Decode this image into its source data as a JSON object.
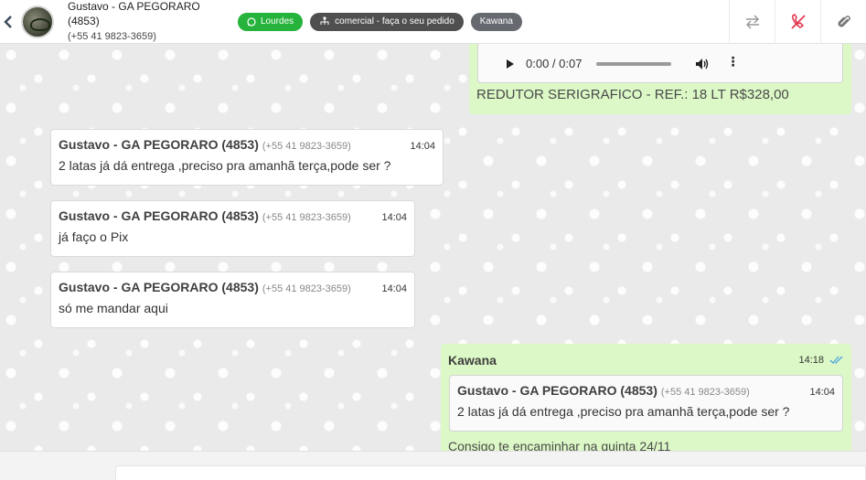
{
  "header": {
    "contact_name": "Gustavo - GA PEGORARO (4853)",
    "contact_phone": "(+55 41 9823-3659)",
    "tags": [
      {
        "label": "Lourdes",
        "icon": "whatsapp-icon",
        "color": "#25b33b"
      },
      {
        "label": "comercial - faça o seu pedido",
        "icon": "sitemap-icon",
        "color": "#4f4f4f"
      },
      {
        "label": "Kawana",
        "color": "#666a70"
      }
    ],
    "actions": [
      "transfer-icon",
      "end-call-icon",
      "attach-icon"
    ]
  },
  "messages": {
    "audio": {
      "time": "0:00 / 0:07",
      "caption": "REDUTOR SERIGRAFICO - REF.: 18 LT R$328,00"
    },
    "incoming": [
      {
        "sender": "Gustavo - GA PEGORARO (4853)",
        "number": "(+55 41 9823-3659)",
        "time": "14:04",
        "text": "2 latas já dá entrega ,preciso pra amanhã terça,pode ser ?"
      },
      {
        "sender": "Gustavo - GA PEGORARO (4853)",
        "number": "(+55 41 9823-3659)",
        "time": "14:04",
        "text": "já faço o Pix"
      },
      {
        "sender": "Gustavo - GA PEGORARO (4853)",
        "number": "(+55 41 9823-3659)",
        "time": "14:04",
        "text": "só me mandar aqui"
      }
    ],
    "outgoing": {
      "sender": "Kawana",
      "time": "14:18",
      "quoted": {
        "sender": "Gustavo - GA PEGORARO (4853)",
        "number": "(+55 41 9823-3659)",
        "time": "14:04",
        "text": "2 latas já dá entrega ,preciso pra amanhã terça,pode ser ?"
      },
      "text": "Consigo te encaminhar na quinta 24/11"
    }
  },
  "colors": {
    "outgoing_bubble": "#dcf8c6",
    "read_ticks": "#4fa3e0",
    "end_call": "#e0314b"
  }
}
